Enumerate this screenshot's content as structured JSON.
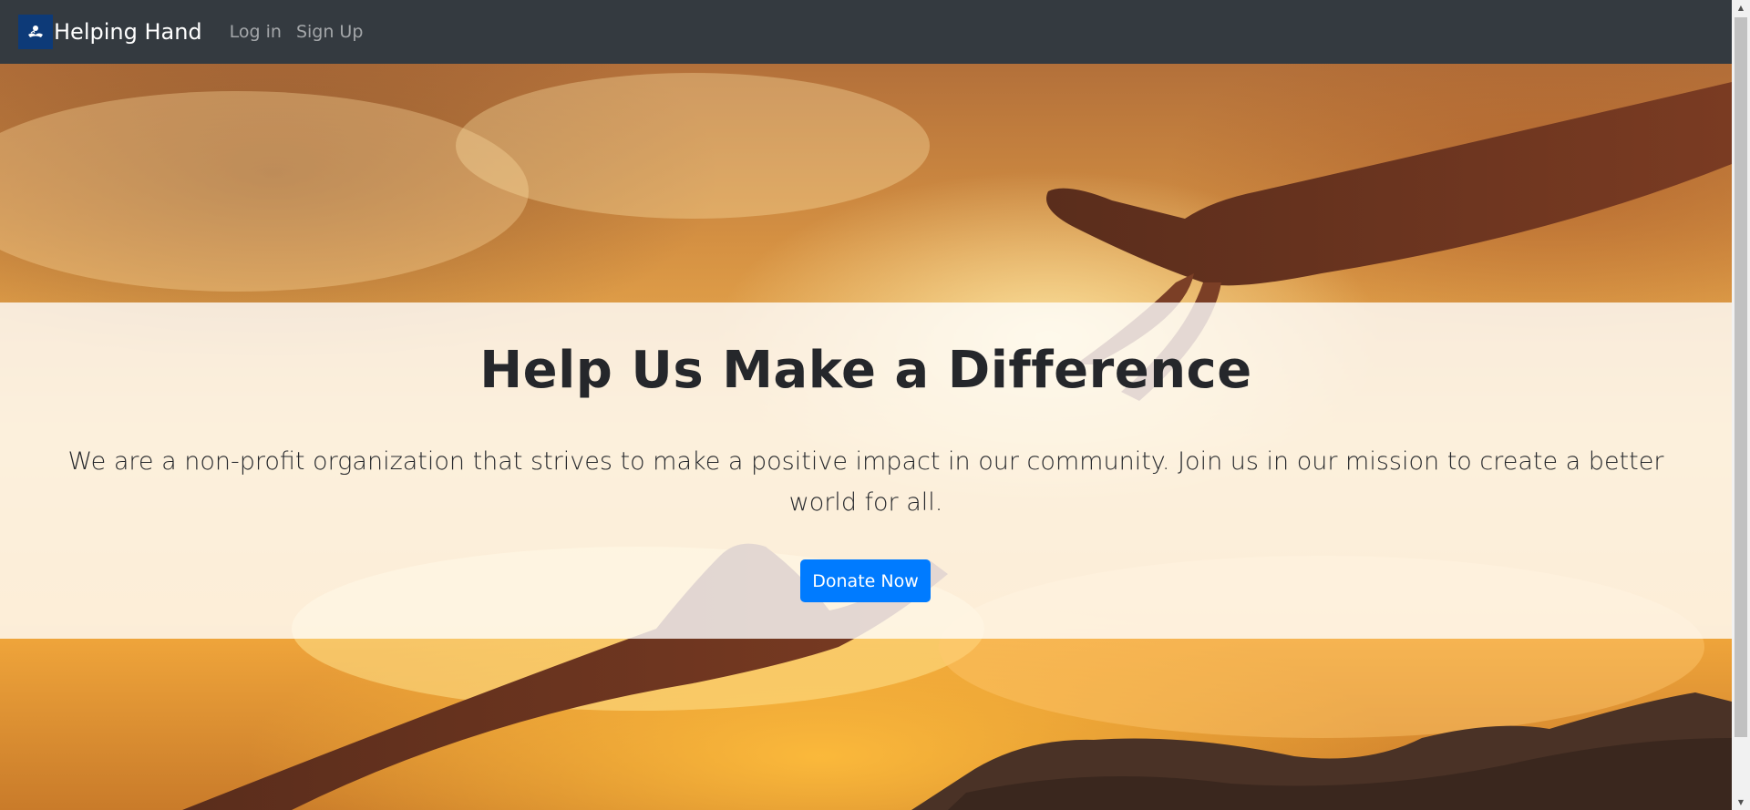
{
  "navbar": {
    "brand_name": "Helping Hand",
    "logo_icon": "helping-hand-logo",
    "links": [
      {
        "label": "Log in"
      },
      {
        "label": "Sign Up"
      }
    ]
  },
  "hero": {
    "title": "Help Us Make a Difference",
    "lead": "We are a non-profit organization that strives to make a positive impact in our community. Join us in our mission to create a better world for all.",
    "cta_label": "Donate Now",
    "background_image": "two hands reaching toward each other against a golden sunset sky"
  },
  "colors": {
    "navbar_bg": "#343a40",
    "brand_logo_bg": "#0d3a78",
    "cta_bg": "#007bff",
    "band_bg": "rgba(255,255,255,0.8)"
  }
}
